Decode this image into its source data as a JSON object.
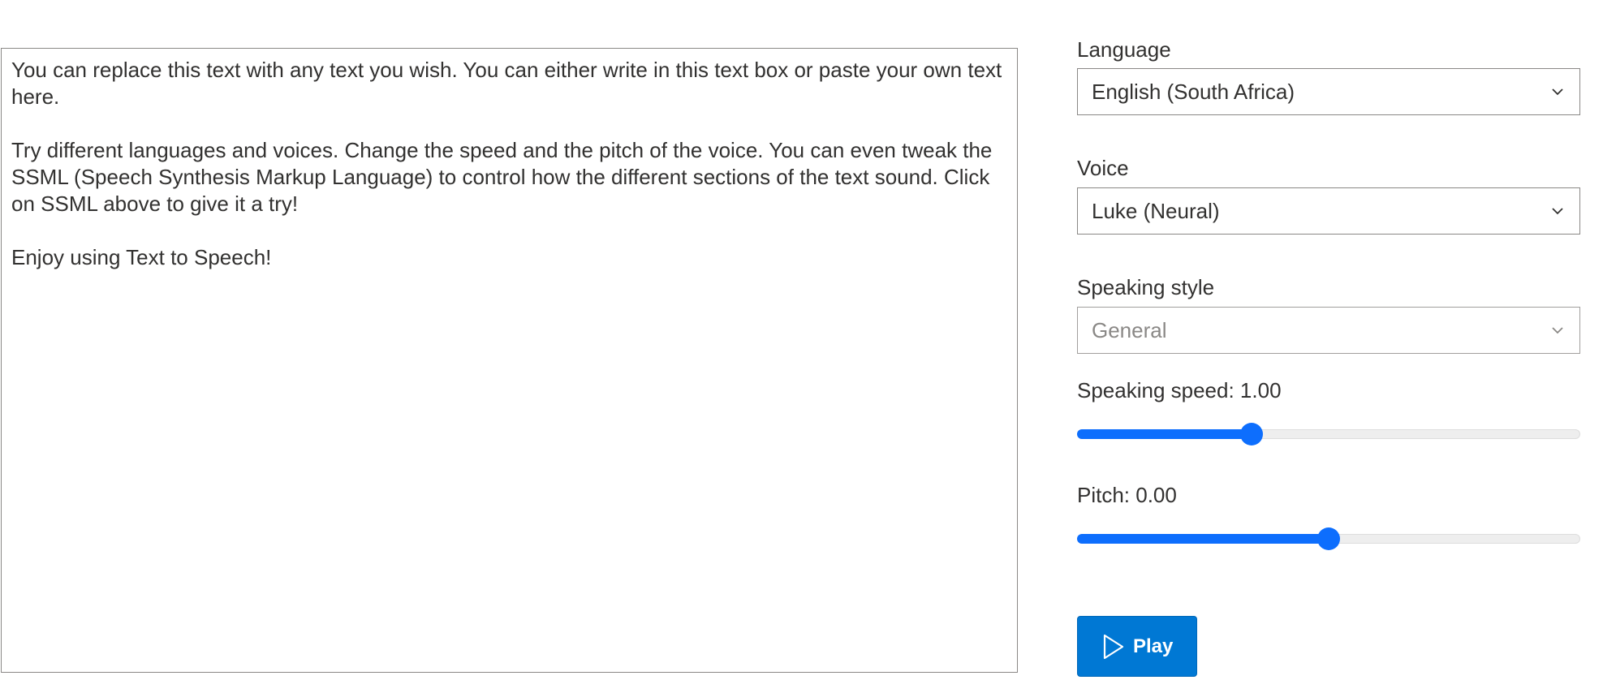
{
  "editor": {
    "text": "You can replace this text with any text you wish. You can either write in this text box or paste your own text here.\n\nTry different languages and voices. Change the speed and the pitch of the voice. You can even tweak the SSML (Speech Synthesis Markup Language) to control how the different sections of the text sound. Click on SSML above to give it a try!\n\nEnjoy using Text to Speech!"
  },
  "settings": {
    "language": {
      "label": "Language",
      "value": "English (South Africa)"
    },
    "voice": {
      "label": "Voice",
      "value": "Luke (Neural)"
    },
    "speaking_style": {
      "label": "Speaking style",
      "value": "General",
      "disabled": true
    },
    "speaking_speed": {
      "label": "Speaking speed: 1.00",
      "value": 1.0,
      "position_fraction": 0.34
    },
    "pitch": {
      "label": "Pitch: 0.00",
      "value": 0.0,
      "position_fraction": 0.5
    }
  },
  "actions": {
    "play_label": "Play"
  },
  "colors": {
    "accent": "#0d6efd",
    "button": "#0078d4"
  },
  "icons": {
    "chevron": "chevron-down-icon",
    "play": "play-icon"
  }
}
